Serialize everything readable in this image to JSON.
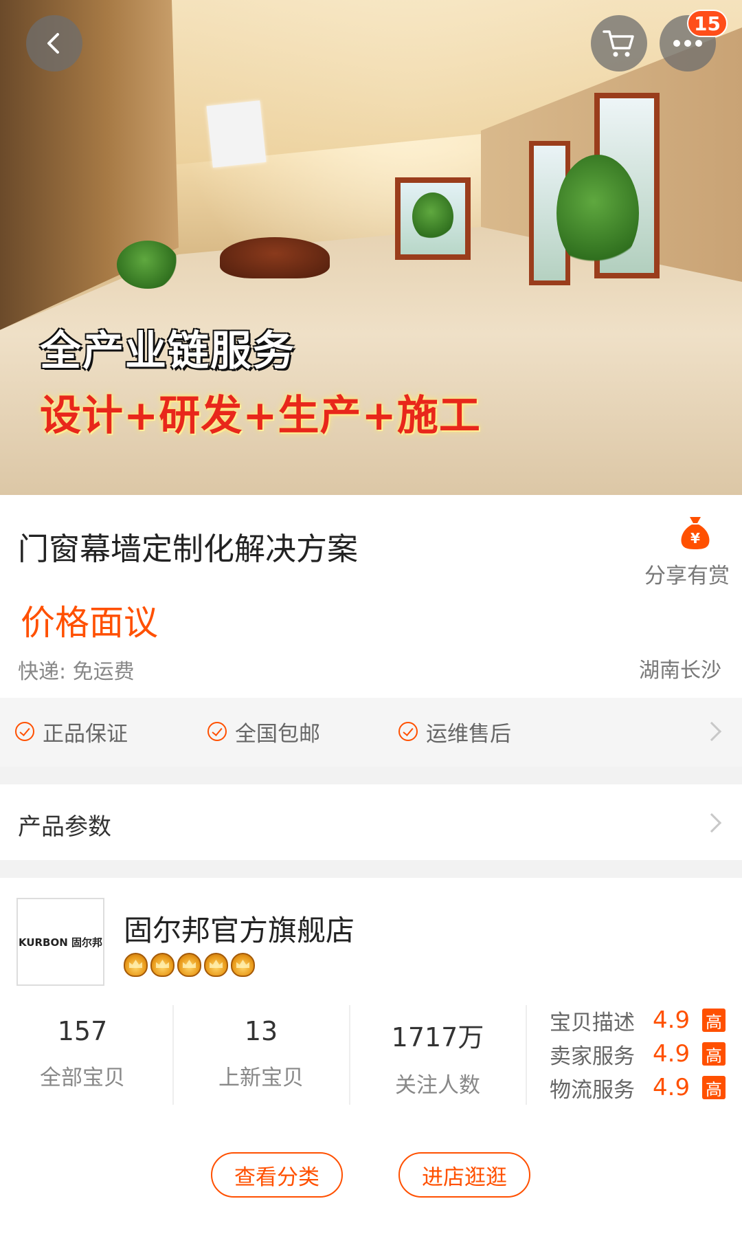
{
  "hero": {
    "headline": "全产业链服务",
    "subheadline": "设计+研发+生产+施工",
    "badge_count": "15"
  },
  "product": {
    "title": "门窗幕墙定制化解决方案",
    "share_label": "分享有赏",
    "price": "价格面议",
    "shipping": "快递: 免运费",
    "location": "湖南长沙"
  },
  "guarantees": [
    {
      "label": "正品保证"
    },
    {
      "label": "全国包邮"
    },
    {
      "label": "运维售后"
    }
  ],
  "params": {
    "label": "产品参数"
  },
  "shop": {
    "logo_text": "KURBON 固尔邦",
    "name": "固尔邦官方旗舰店",
    "crown_count": 5,
    "stats": [
      {
        "value": "157",
        "label": "全部宝贝"
      },
      {
        "value": "13",
        "label": "上新宝贝"
      },
      {
        "value": "1717万",
        "label": "关注人数"
      }
    ],
    "scores": [
      {
        "label": "宝贝描述",
        "value": "4.9",
        "tag": "高"
      },
      {
        "label": "卖家服务",
        "value": "4.9",
        "tag": "高"
      },
      {
        "label": "物流服务",
        "value": "4.9",
        "tag": "高"
      }
    ],
    "buttons": {
      "categories": "查看分类",
      "visit": "进店逛逛"
    }
  },
  "colors": {
    "accent": "#ff5000",
    "headline_red": "#e8271b"
  }
}
